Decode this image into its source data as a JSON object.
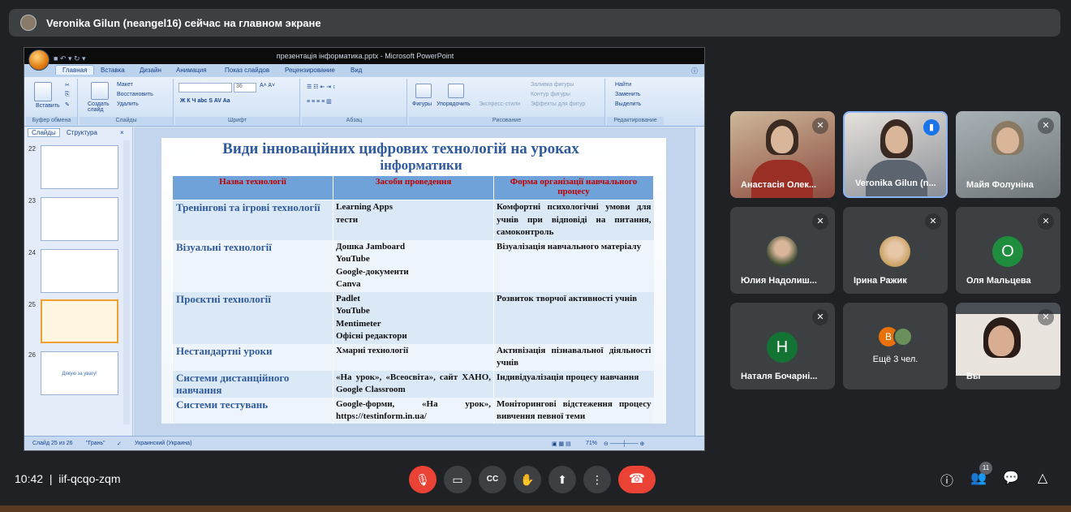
{
  "meet": {
    "presenter_banner": "Veronika Gilun (neangel16) сейчас на главном экране",
    "clock": "10:42",
    "meeting_code": "iif-qcqo-zqm",
    "participants_count": "11"
  },
  "ppt": {
    "window_title": "презентація інформатика.pptx - Microsoft PowerPoint",
    "tabs": [
      "Главная",
      "Вставка",
      "Дизайн",
      "Анимация",
      "Показ слайдов",
      "Рецензирование",
      "Вид"
    ],
    "groups": {
      "clipboard": "Буфер обмена",
      "slides": "Слайды",
      "font": "Шрифт",
      "paragraph": "Абзац",
      "drawing": "Рисование",
      "editing": "Редактирование"
    },
    "buttons": {
      "paste": "Вставить",
      "new_slide": "Создать слайд",
      "layout": "Макет",
      "reset": "Восстановить",
      "delete": "Удалить",
      "shapes": "Фигуры",
      "arrange": "Упорядочить",
      "express": "Экспресс-стили",
      "fill": "Заливка фигуры",
      "outline": "Контур фигуры",
      "effects": "Эффекты для фигур",
      "find": "Найти",
      "replace": "Заменить",
      "select": "Выделить",
      "font_size": "36"
    },
    "pane_tabs": {
      "slides": "Слайды",
      "outline": "Структура"
    },
    "thumbs": [
      "22",
      "23",
      "24",
      "25",
      "26"
    ],
    "thumb26_text": "Дякую за увагу!",
    "status": {
      "slide": "Слайд 25 из 26",
      "theme": "\"Грань\"",
      "lang": "Украинский (Украина)",
      "zoom": "71%"
    }
  },
  "slide": {
    "title_line1": "Види інноваційних цифрових технологій на уроках",
    "title_line2": "інформатики",
    "headers": [
      "Назва технології",
      "Засоби проведення",
      "Форма організації навчального процесу"
    ],
    "rows": [
      {
        "name": "Тренінгові та ігрові технології",
        "tools": [
          "Learning Apps",
          "тести"
        ],
        "form": "Комфортні психологічні умови для учнів при відповіді на питання, самоконтроль"
      },
      {
        "name": "Візуальні технології",
        "tools": [
          "Дошка Jamboard",
          "YouTube",
          "Google-документи",
          "Canva"
        ],
        "form": "Візуалізація навчального матеріалу"
      },
      {
        "name": "Проєктні технології",
        "tools": [
          "Padlet",
          "YouTube",
          "Mentimeter",
          "Офісні редактори"
        ],
        "form": "Розвиток творчої активності учнів"
      },
      {
        "name": "Нестандартні уроки",
        "tools": [
          "Хмарні технології"
        ],
        "form": "Активізація пізнавальної діяльності учнів"
      },
      {
        "name": "Системи дистанційного навчання",
        "tools": [
          "«На урок», «Всеосвіта», сайт ХАНО, Google Classroom"
        ],
        "form": "Індивідуалізація процесу навчання"
      },
      {
        "name": "Системи тестувань",
        "tools": [
          "Google-форми, «На урок», https://testinform.in.ua/"
        ],
        "form": "Моніторингові відстеження процесу вивчення певної теми"
      }
    ]
  },
  "tiles": [
    {
      "name": "Анастасія Олек...",
      "type": "video"
    },
    {
      "name": "Veronika Gilun (n...",
      "type": "video"
    },
    {
      "name": "Майя Фолуніна",
      "type": "video"
    },
    {
      "name": "Юлия Надолиш...",
      "type": "avatar"
    },
    {
      "name": "Ірина Ражик",
      "type": "avatar"
    },
    {
      "name": "Оля Мальцева",
      "type": "letter",
      "letter": "О",
      "color": "#1e8e3e"
    },
    {
      "name": "Наталя Бочарні...",
      "type": "letter",
      "letter": "Н",
      "color": "#137333"
    },
    {
      "name": "Ещё 3 чел.",
      "type": "more",
      "letter": "В",
      "color": "#e8710a"
    },
    {
      "name": "Вы",
      "type": "video"
    }
  ]
}
